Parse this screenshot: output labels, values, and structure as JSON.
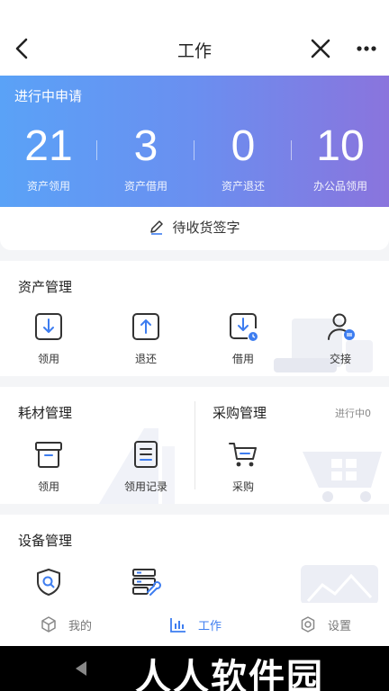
{
  "header": {
    "title": "工作"
  },
  "hero": {
    "label": "进行中申请",
    "stats": [
      {
        "value": "21",
        "caption": "资产领用"
      },
      {
        "value": "3",
        "caption": "资产借用"
      },
      {
        "value": "0",
        "caption": "资产退还"
      },
      {
        "value": "10",
        "caption": "办公品领用"
      }
    ]
  },
  "sign": {
    "label": "待收货签字"
  },
  "asset": {
    "heading": "资产管理",
    "items": [
      {
        "label": "领用",
        "icon": "download-box-icon"
      },
      {
        "label": "退还",
        "icon": "upload-box-icon"
      },
      {
        "label": "借用",
        "icon": "borrow-clock-icon"
      },
      {
        "label": "交接",
        "icon": "user-transfer-icon"
      }
    ]
  },
  "consumable": {
    "heading": "耗材管理",
    "items": [
      {
        "label": "领用",
        "icon": "archive-box-icon"
      },
      {
        "label": "领用记录",
        "icon": "document-list-icon"
      }
    ]
  },
  "purchase": {
    "heading": "采购管理",
    "status": "进行中0",
    "items": [
      {
        "label": "采购",
        "icon": "cart-icon"
      }
    ]
  },
  "device": {
    "heading": "设备管理",
    "items": [
      {
        "label": "",
        "icon": "shield-search-icon"
      },
      {
        "label": "",
        "icon": "server-wrench-icon"
      }
    ]
  },
  "tabs": [
    {
      "label": "我的",
      "icon": "cube-icon",
      "active": false
    },
    {
      "label": "工作",
      "icon": "bar-chart-icon",
      "active": true
    },
    {
      "label": "设置",
      "icon": "gear-icon",
      "active": false
    }
  ],
  "watermark": "人人软件园",
  "colors": {
    "accent": "#3d7df0",
    "gradient_start": "#5aa2f7",
    "gradient_end": "#8a74dd"
  }
}
